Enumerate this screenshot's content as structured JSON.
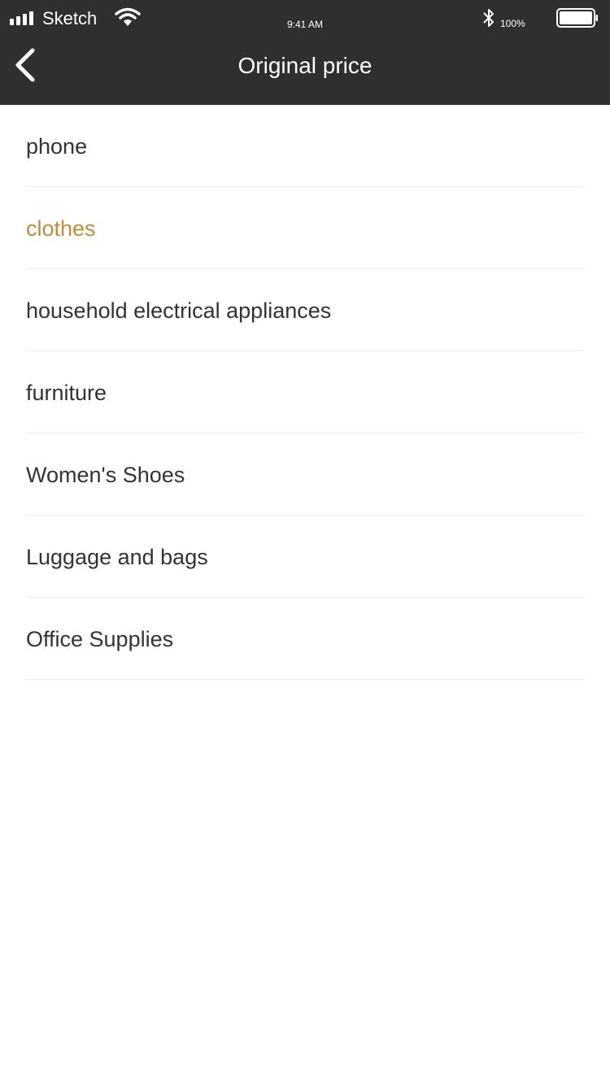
{
  "status_bar": {
    "carrier": "Sketch",
    "time": "9:41 AM",
    "battery": "100%"
  },
  "header": {
    "title": "Original price",
    "background": "#2f2f2f"
  },
  "list": {
    "items": [
      {
        "label": "phone"
      },
      {
        "label": "clothes"
      },
      {
        "label": "household electrical appliances"
      },
      {
        "label": "furniture"
      },
      {
        "label": "Women's Shoes"
      },
      {
        "label": "Luggage and bags"
      },
      {
        "label": "Office Supplies"
      }
    ],
    "selected": "clothes",
    "selected_color": "#c08b3a"
  }
}
